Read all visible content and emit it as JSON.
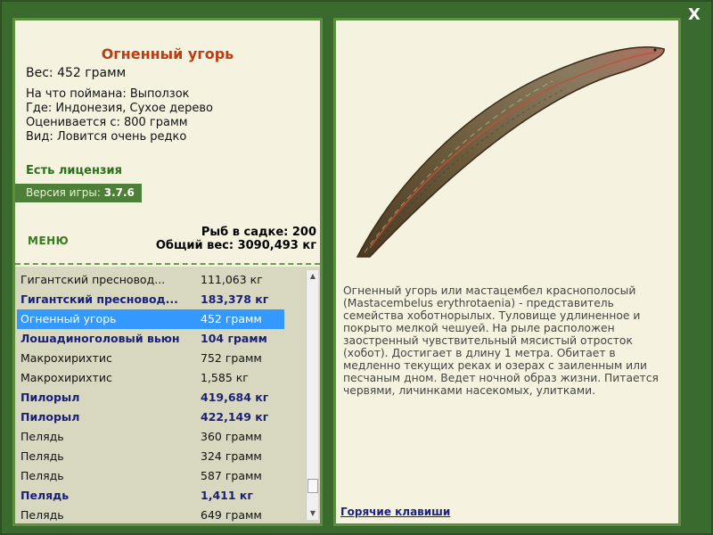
{
  "window": {
    "close_label": "X"
  },
  "fish": {
    "title": "Огненный угорь",
    "weight_line": "Вес: 452 грамм",
    "bait": "На что поймана: Выползок",
    "location": "Где: Индонезия, Сухое дерево",
    "value": "Оценивается с: 800 грамм",
    "rarity": "Вид: Ловится очень редко",
    "license": "Есть лицензия",
    "description": "Огненный угорь или мастацембел краснополосый (Mastacembelus erythrotaenia) - представитель семейства хоботнорылых. Туловище удлиненное и покрыто мелкой чешуей. На рыле расположен заостренный чувствительный мясистый отросток (хобот). Достигает в длину 1 метра. Обитает в медленно текущих реках и озерах с заиленным или песчаным дном. Ведет ночной образ жизни. Питается червями, личинками насекомых, улитками."
  },
  "version": {
    "label": "Версия игры:",
    "value": "3.7.6"
  },
  "menu_label": "МЕНЮ",
  "stats": {
    "count_line": "Рыб в садке: 200",
    "total_line": "Общий вес: 3090,493 кг"
  },
  "catch_list": [
    {
      "name": "Гигантский пресновод...",
      "weight": "111,063 кг",
      "style": "normal"
    },
    {
      "name": "Гигантский пресновод...",
      "weight": "183,378 кг",
      "style": "bold"
    },
    {
      "name": "Огненный угорь",
      "weight": "452 грамм",
      "style": "selected"
    },
    {
      "name": "Лошадиноголовый вьюн",
      "weight": "104 грамм",
      "style": "bold"
    },
    {
      "name": "Макрохирихтис",
      "weight": "752 грамм",
      "style": "normal"
    },
    {
      "name": "Макрохирихтис",
      "weight": "1,585 кг",
      "style": "normal"
    },
    {
      "name": "Пилорыл",
      "weight": "419,684 кг",
      "style": "bold"
    },
    {
      "name": "Пилорыл",
      "weight": "422,149 кг",
      "style": "bold"
    },
    {
      "name": "Пелядь",
      "weight": "360 грамм",
      "style": "normal"
    },
    {
      "name": "Пелядь",
      "weight": "324 грамм",
      "style": "normal"
    },
    {
      "name": "Пелядь",
      "weight": "587 грамм",
      "style": "normal"
    },
    {
      "name": "Пелядь",
      "weight": "1,411 кг",
      "style": "bold"
    },
    {
      "name": "Пелядь",
      "weight": "649 грамм",
      "style": "normal"
    }
  ],
  "hotkeys_label": "Горячие клавиши",
  "colors": {
    "frame_green": "#3b6a2f",
    "panel_bg": "#f5f3df",
    "title_red": "#c03a12",
    "bold_blue": "#1a1f7a",
    "selection": "#3399ff"
  }
}
